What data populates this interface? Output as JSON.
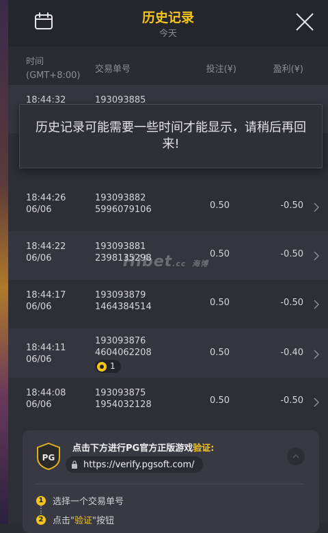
{
  "header": {
    "title": "历史记录",
    "subtitle": "今天"
  },
  "columns": {
    "time_line1": "时间",
    "time_line2": "(GMT+8:00)",
    "order": "交易单号",
    "bet": "投注(¥)",
    "profit": "盈利(¥)"
  },
  "partial_row": {
    "time": "18:44:32",
    "order_line1": "193093885"
  },
  "notice": "历史记录可能需要一些时间才能显示，请稍后再回来!",
  "rows": [
    {
      "time": "18:44:26",
      "date": "06/06",
      "order_line1": "193093882",
      "order_line2": "5996079106",
      "bet": "0.50",
      "profit": "-0.50"
    },
    {
      "time": "18:44:22",
      "date": "06/06",
      "order_line1": "193093881",
      "order_line2": "2398135298",
      "bet": "0.50",
      "profit": "-0.50"
    },
    {
      "time": "18:44:17",
      "date": "06/06",
      "order_line1": "193093879",
      "order_line2": "1464384514",
      "bet": "0.50",
      "profit": "-0.50"
    },
    {
      "time": "18:44:11",
      "date": "06/06",
      "order_line1": "193093876",
      "order_line2": "4604062208",
      "tag_count": "1",
      "bet": "0.50",
      "profit": "-0.40"
    },
    {
      "time": "18:44:08",
      "date": "06/06",
      "order_line1": "193093875",
      "order_line2": "1954032128",
      "bet": "0.50",
      "profit": "-0.50"
    }
  ],
  "watermark": {
    "text": "Hibet",
    "suffix": ".cc",
    "cjk": "海博"
  },
  "verify": {
    "badge_text": "PG",
    "text_before": "点击下方进行PG官方正版游戏",
    "text_highlight": "验证:",
    "url": "https://verify.pgsoft.com/",
    "step1_num": "1",
    "step1": "选择一个交易单号",
    "step2_num": "2",
    "step2_before": "点击\"",
    "step2_highlight": "验证",
    "step2_after": "\"按钮"
  },
  "colors": {
    "accent": "#f4c51c",
    "background": "#2e2e37"
  }
}
